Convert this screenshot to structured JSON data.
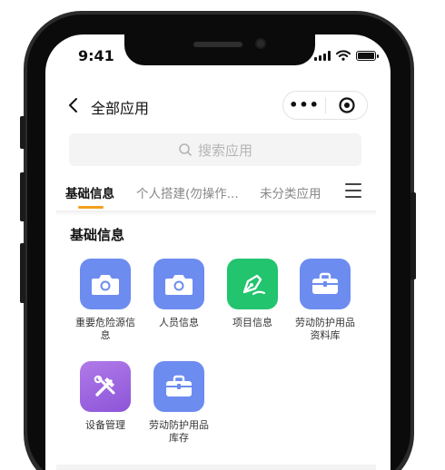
{
  "status_bar": {
    "time": "9:41"
  },
  "nav": {
    "title": "全部应用",
    "more_label": "•••"
  },
  "search": {
    "placeholder": "搜索应用"
  },
  "tabs": [
    {
      "label": "基础信息",
      "active": true
    },
    {
      "label": "个人搭建(勿操作...",
      "active": false
    },
    {
      "label": "未分类应用",
      "active": false
    }
  ],
  "section": {
    "title": "基础信息"
  },
  "apps": [
    {
      "label": "重要危险源信息",
      "icon": "camera-icon",
      "color": "#6d8cf0"
    },
    {
      "label": "人员信息",
      "icon": "camera-icon",
      "color": "#6d8cf0"
    },
    {
      "label": "项目信息",
      "icon": "pen-nib-icon",
      "color": "#22c46e"
    },
    {
      "label": "劳动防护用品资料库",
      "icon": "toolbox-icon",
      "color": "#6d8cf0"
    },
    {
      "label": "设备管理",
      "icon": "tools-icon",
      "color": "#9b62e0"
    },
    {
      "label": "劳动防护用品库存",
      "icon": "toolbox-icon",
      "color": "#6d8cf0"
    }
  ],
  "colors": {
    "accent": "#f1a11c",
    "blue_tile": "#6d8cf0",
    "green_tile": "#22c46e",
    "purple_tile": "#9b62e0"
  }
}
